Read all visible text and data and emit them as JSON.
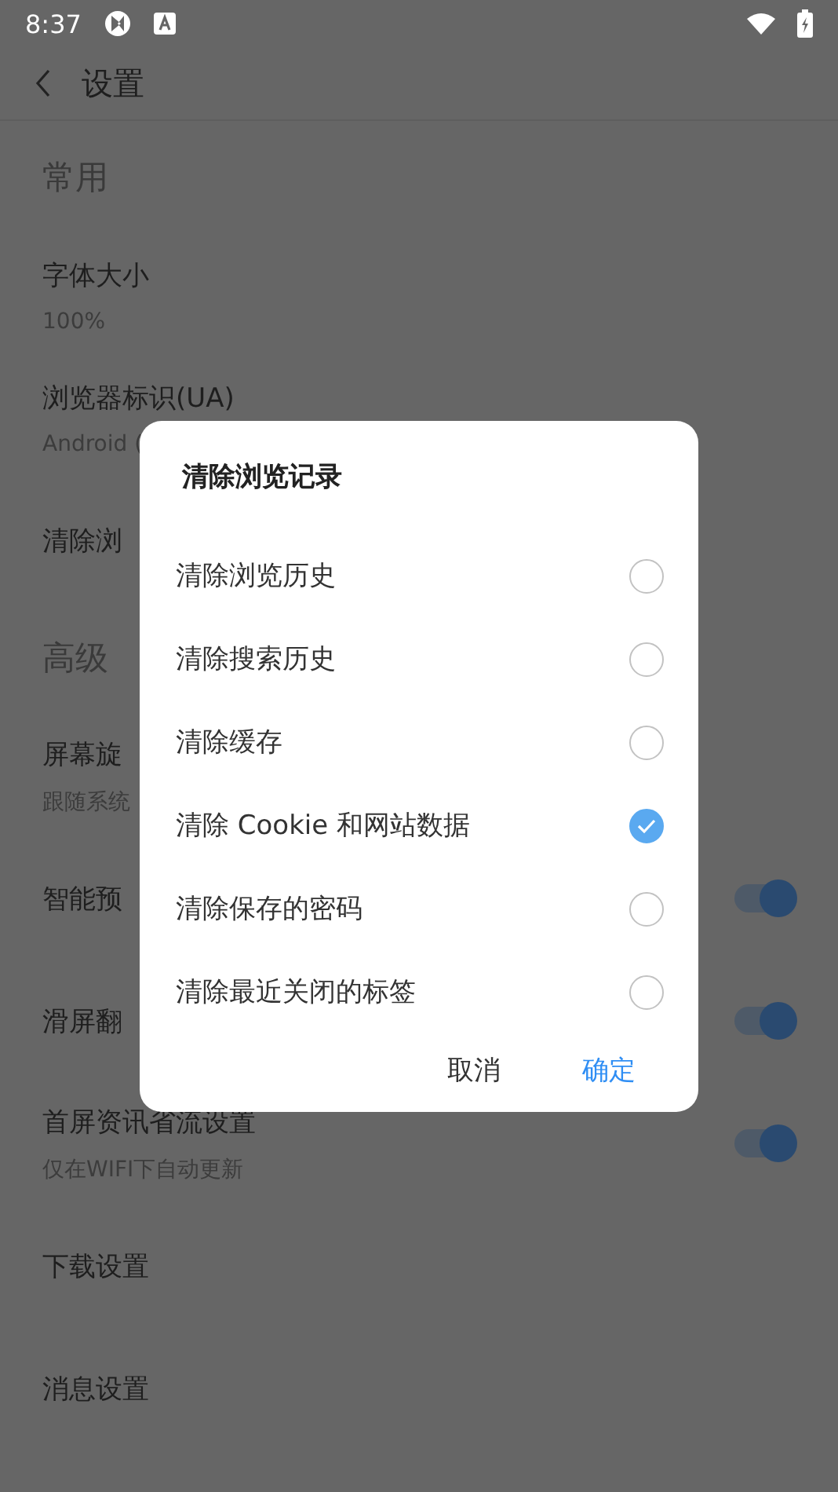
{
  "status_bar": {
    "time": "8:37"
  },
  "header": {
    "title": "设置"
  },
  "settings": [
    {
      "kind": "section",
      "title": "常用"
    },
    {
      "kind": "row",
      "title": "字体大小",
      "subtitle": "100%"
    },
    {
      "kind": "row",
      "title": "浏览器标识(UA)",
      "subtitle": "Android ("
    },
    {
      "kind": "row",
      "title": "清除浏"
    },
    {
      "kind": "section",
      "title": "高级"
    },
    {
      "kind": "row",
      "title": "屏幕旋",
      "subtitle": "跟随系统"
    },
    {
      "kind": "toggle",
      "title": "智能预",
      "on": true
    },
    {
      "kind": "toggle",
      "title": "滑屏翻",
      "on": true
    },
    {
      "kind": "toggle",
      "title": "首屏资讯省流设置",
      "subtitle": "仅在WIFI下自动更新",
      "on": true
    },
    {
      "kind": "row",
      "title": "下载设置"
    },
    {
      "kind": "row",
      "title": "消息设置"
    }
  ],
  "dialog": {
    "title": "清除浏览记录",
    "options": [
      {
        "label": "清除浏览历史",
        "checked": false
      },
      {
        "label": "清除搜索历史",
        "checked": false
      },
      {
        "label": "清除缓存",
        "checked": false
      },
      {
        "label": "清除 Cookie 和网站数据",
        "checked": true
      },
      {
        "label": "清除保存的密码",
        "checked": false
      },
      {
        "label": "清除最近关闭的标签",
        "checked": false
      }
    ],
    "cancel": "取消",
    "confirm": "确定"
  }
}
